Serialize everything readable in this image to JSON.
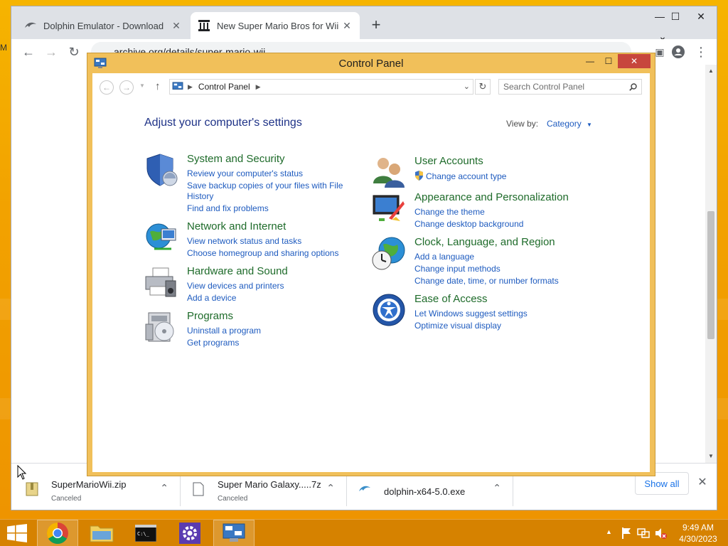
{
  "browser": {
    "tabs": [
      {
        "label": "Dolphin Emulator - Download",
        "icon": "dolphin-icon",
        "close": "✕"
      },
      {
        "label": "New Super Mario Bros for Wii : N",
        "icon": "archive-icon",
        "close": "✕"
      }
    ],
    "new_tab": "+",
    "window_controls": {
      "minimize": "—",
      "maximize": "☐",
      "close": "✕",
      "tab_search": "⌄"
    },
    "url": "archive.org/details/super-mario-wii",
    "nav": {
      "back": "←",
      "forward": "→",
      "reload": "↻"
    }
  },
  "downloads": {
    "items": [
      {
        "name": "SuperMarioWii.zip",
        "status": "Canceled",
        "icon": "zip-file-icon"
      },
      {
        "name": "Super Mario Galaxy.....7z",
        "status": "Canceled",
        "icon": "file-icon"
      },
      {
        "name": "dolphin-x64-5.0.exe",
        "status": "",
        "icon": "dolphin-icon"
      }
    ],
    "show_all": "Show all",
    "close": "✕",
    "chevron": "⌃"
  },
  "control_panel": {
    "title": "Control Panel",
    "controls": {
      "minimize": "—",
      "maximize": "☐",
      "close": "✕"
    },
    "address": "Control Panel",
    "search_placeholder": "Search Control Panel",
    "heading": "Adjust your computer's settings",
    "view_by_label": "View by:",
    "view_by_value": "Category",
    "categories_left": [
      {
        "title": "System and Security",
        "icon": "shield-icon",
        "links": [
          "Review your computer's status",
          "Save backup copies of your files with File",
          "History",
          "Find and fix problems"
        ]
      },
      {
        "title": "Network and Internet",
        "icon": "network-globe-icon",
        "links": [
          "View network status and tasks",
          "Choose homegroup and sharing options"
        ]
      },
      {
        "title": "Hardware and Sound",
        "icon": "printer-icon",
        "links": [
          "View devices and printers",
          "Add a device"
        ]
      },
      {
        "title": "Programs",
        "icon": "programs-icon",
        "links": [
          "Uninstall a program",
          "Get programs"
        ]
      }
    ],
    "categories_right": [
      {
        "title": "User Accounts",
        "icon": "users-icon",
        "links": [
          "Change account type"
        ]
      },
      {
        "title": "Appearance and Personalization",
        "icon": "monitor-paint-icon",
        "links": [
          "Change the theme",
          "Change desktop background"
        ]
      },
      {
        "title": "Clock, Language, and Region",
        "icon": "clock-globe-icon",
        "links": [
          "Add a language",
          "Change input methods",
          "Change date, time, or number formats"
        ]
      },
      {
        "title": "Ease of Access",
        "icon": "ease-of-access-icon",
        "links": [
          "Let Windows suggest settings",
          "Optimize visual display"
        ]
      }
    ]
  },
  "taskbar": {
    "time": "9:49 AM",
    "date": "4/30/2023",
    "apps": [
      "start-icon",
      "chrome-icon",
      "file-explorer-icon",
      "cmd-icon",
      "settings-icon",
      "control-panel-icon"
    ]
  },
  "colors": {
    "desktop": "#f2a200",
    "taskbar": "#d68200",
    "cp_frame": "#f1c05a",
    "link": "#1e5bbf",
    "category_title": "#1e6b2a",
    "heading": "#1e3287"
  }
}
